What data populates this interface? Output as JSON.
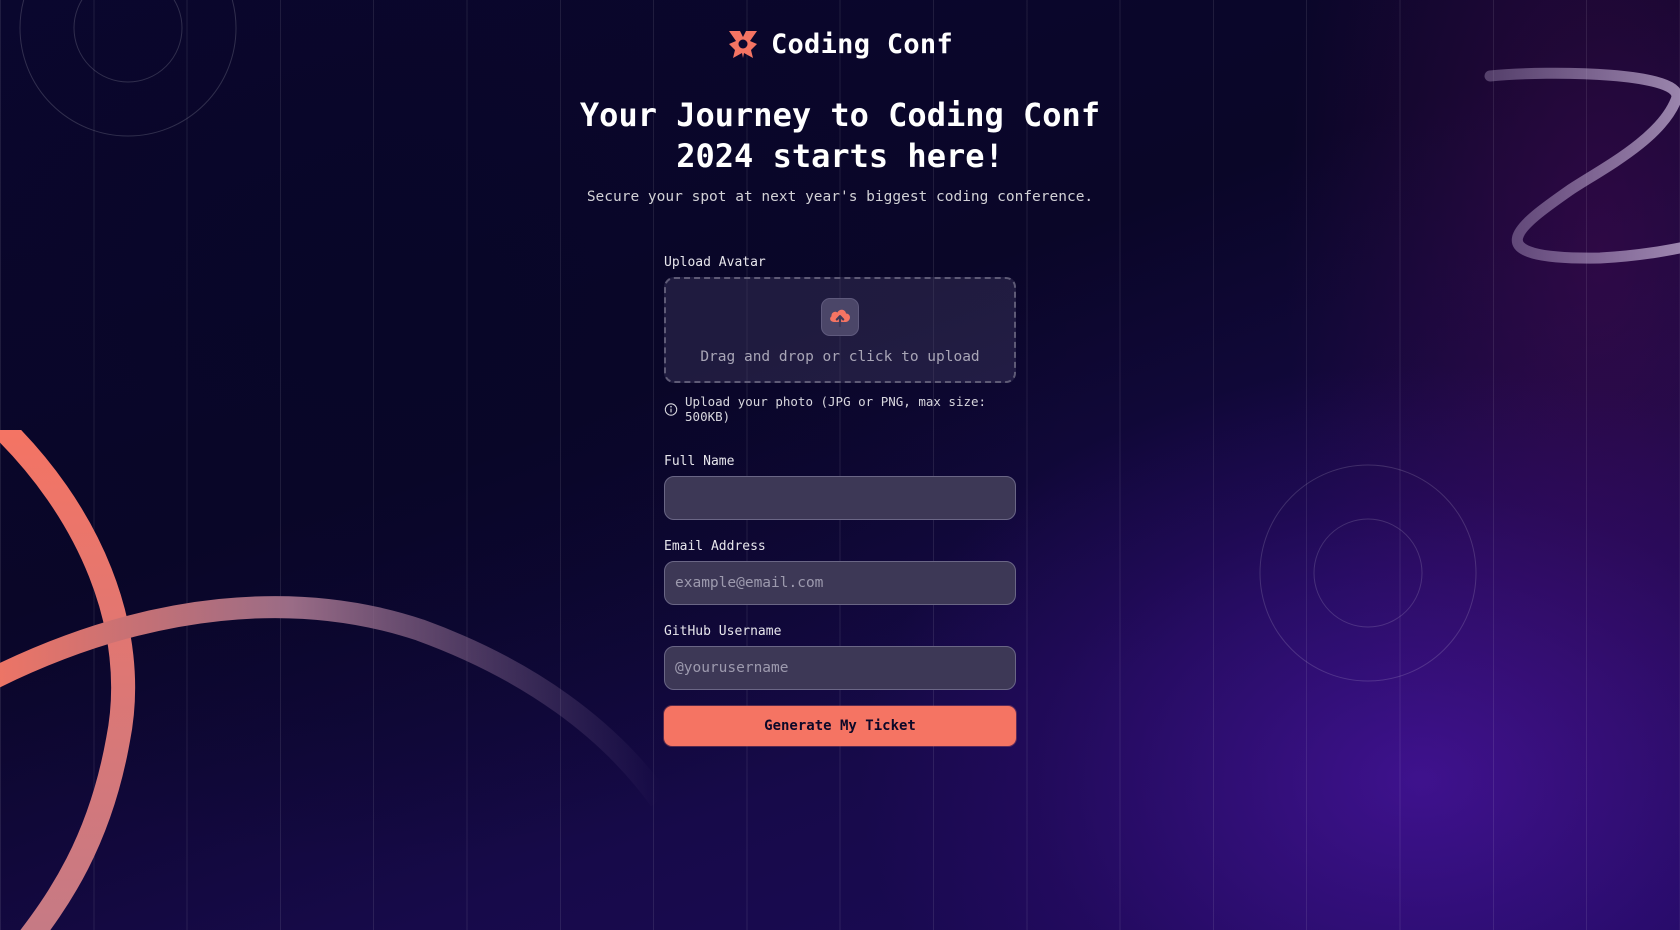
{
  "brand": {
    "name": "Coding Conf",
    "logo_icon": "logo-mark-icon",
    "accent": "#f57463"
  },
  "hero": {
    "title_line1": "Your Journey to Coding Conf",
    "title_line2": "2024 starts here!",
    "subtitle": "Secure your spot at next year's biggest coding conference."
  },
  "form": {
    "avatar": {
      "label": "Upload Avatar",
      "dropzone_text": "Drag and drop or click to upload",
      "upload_icon": "cloud-upload-icon",
      "hint_icon": "info-icon",
      "hint": "Upload your photo (JPG or PNG, max size: 500KB)"
    },
    "full_name": {
      "label": "Full Name",
      "value": "",
      "placeholder": ""
    },
    "email": {
      "label": "Email Address",
      "value": "",
      "placeholder": "example@email.com"
    },
    "github": {
      "label": "GitHub Username",
      "value": "",
      "placeholder": "@yourusername"
    },
    "submit_label": "Generate My Ticket"
  }
}
